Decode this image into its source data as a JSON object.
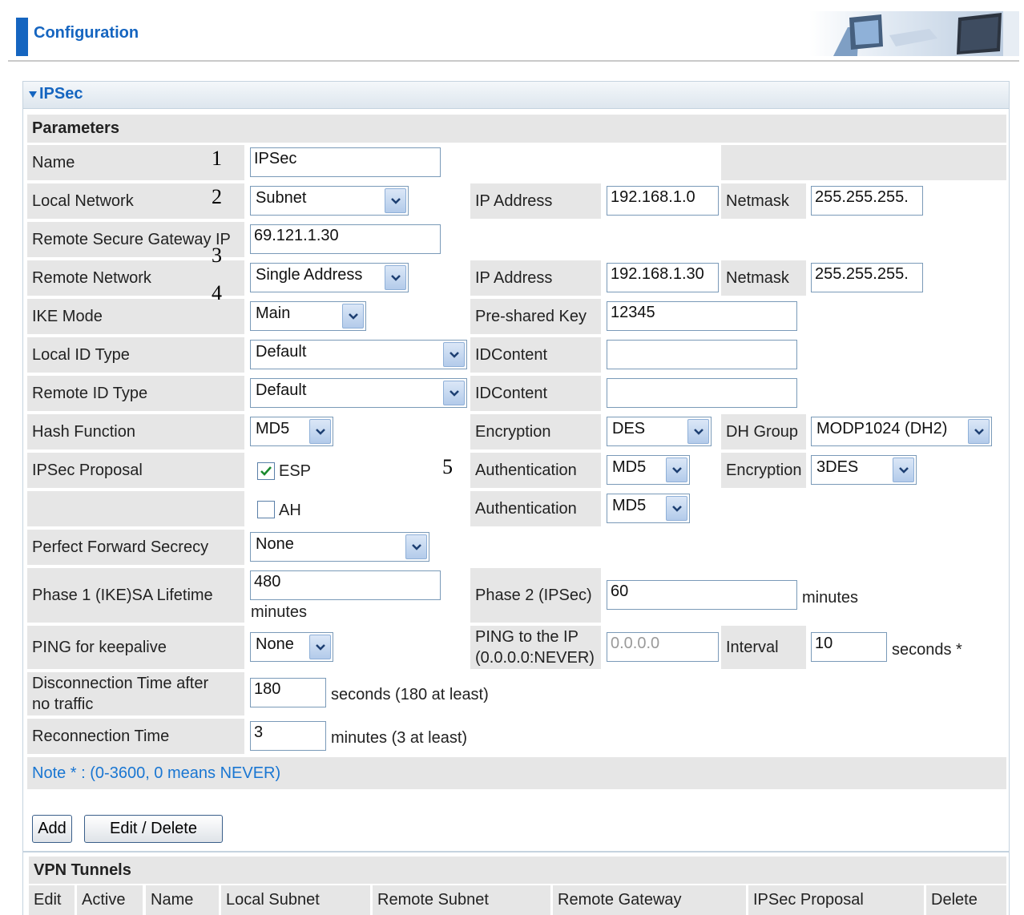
{
  "header": {
    "title": "Configuration"
  },
  "section": {
    "title": "IPSec",
    "params_label": "Parameters"
  },
  "callouts": {
    "c1": "1",
    "c2": "2",
    "c3": "3",
    "c4": "4",
    "c5": "5"
  },
  "fields": {
    "name": {
      "label": "Name",
      "value": "IPSec"
    },
    "local_network": {
      "label": "Local Network",
      "value": "Subnet",
      "ip_label": "IP Address",
      "ip": "192.168.1.0",
      "mask_label": "Netmask",
      "mask": "255.255.255."
    },
    "remote_gateway": {
      "label": "Remote Secure Gateway IP",
      "value": "69.121.1.30"
    },
    "remote_network": {
      "label": "Remote Network",
      "value": "Single Address",
      "ip_label": "IP Address",
      "ip": "192.168.1.30",
      "mask_label": "Netmask",
      "mask": "255.255.255."
    },
    "ike_mode": {
      "label": "IKE Mode",
      "value": "Main",
      "psk_label": "Pre-shared Key",
      "psk": "12345"
    },
    "local_id": {
      "label": "Local ID Type",
      "value": "Default",
      "content_label": "IDContent",
      "content": ""
    },
    "remote_id": {
      "label": "Remote ID Type",
      "value": "Default",
      "content_label": "IDContent",
      "content": ""
    },
    "hash": {
      "label": "Hash Function",
      "value": "MD5",
      "enc_label": "Encryption",
      "enc": "DES",
      "dh_label": "DH Group",
      "dh": "MODP1024 (DH2)"
    },
    "proposal": {
      "label": "IPSec Proposal",
      "esp_label": "ESP",
      "esp_checked": true,
      "esp_auth_label": "Authentication",
      "esp_auth": "MD5",
      "esp_enc_label": "Encryption",
      "esp_enc": "3DES",
      "ah_label": "AH",
      "ah_checked": false,
      "ah_auth_label": "Authentication",
      "ah_auth": "MD5"
    },
    "pfs": {
      "label": "Perfect Forward Secrecy",
      "value": "None"
    },
    "phase1": {
      "label": "Phase 1 (IKE)SA Lifetime",
      "value": "480",
      "unit": "minutes",
      "phase2_label": "Phase 2 (IPSec)",
      "phase2": "60",
      "phase2_unit": "minutes"
    },
    "ping": {
      "label": "PING for keepalive",
      "value": "None",
      "ping_ip_label1": "PING to the IP",
      "ping_ip_label2": "(0.0.0.0:NEVER)",
      "ping_ip": "0.0.0.0",
      "interval_label": "Interval",
      "interval": "10",
      "interval_unit": "seconds *"
    },
    "disconnect": {
      "label1": "Disconnection Time after",
      "label2": "no traffic",
      "value": "180",
      "unit": "seconds (180 at least)"
    },
    "reconnect": {
      "label": "Reconnection Time",
      "value": "3",
      "unit": "minutes (3 at least)"
    }
  },
  "note": "Note * : (0-3600, 0 means NEVER)",
  "buttons": {
    "add": "Add",
    "edit_delete": "Edit / Delete"
  },
  "tunnels": {
    "title": "VPN Tunnels",
    "columns": [
      "Edit",
      "Active",
      "Name",
      "Local Subnet",
      "Remote Subnet",
      "Remote Gateway",
      "IPSec Proposal",
      "Delete"
    ]
  },
  "colors": {
    "accent": "#1565c0",
    "label_bg": "#e6e6e6",
    "note": "#1976d2"
  }
}
